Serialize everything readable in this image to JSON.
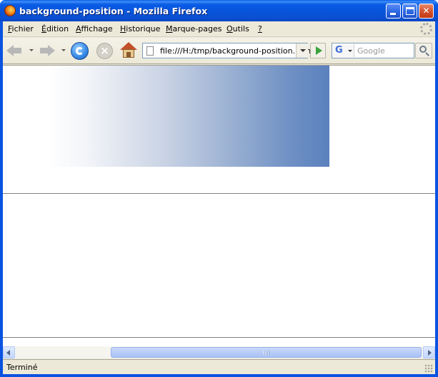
{
  "window": {
    "title": "background-position - Mozilla Firefox"
  },
  "menu": {
    "items": [
      {
        "label": "Fichier",
        "accel": "F",
        "rest": "ichier"
      },
      {
        "label": "Édition",
        "accel": "É",
        "rest": "dition"
      },
      {
        "label": "Affichage",
        "accel": "A",
        "rest": "ffichage"
      },
      {
        "label": "Historique",
        "accel": "H",
        "rest": "istorique"
      },
      {
        "label": "Marque-pages",
        "accel": "M",
        "rest": "arque-pages"
      },
      {
        "label": "Outils",
        "accel": "O",
        "rest": "utils"
      },
      {
        "label": "?",
        "accel": "?",
        "rest": ""
      }
    ]
  },
  "navigation": {
    "url": "file:///H:/tmp/background-position.htm",
    "search_placeholder": "Google",
    "search_engine_letter": "G"
  },
  "status": {
    "text": "Terminé"
  },
  "colors": {
    "titlebar": "#0a53e0",
    "gradient_start": "#ffffff",
    "gradient_end": "#5a80bd"
  },
  "icons": {
    "app": "firefox-icon",
    "back": "back-arrow-icon",
    "forward": "forward-arrow-icon",
    "reload": "reload-icon",
    "stop": "stop-icon",
    "home": "home-icon",
    "go": "go-arrow-icon",
    "search": "magnifier-icon"
  }
}
